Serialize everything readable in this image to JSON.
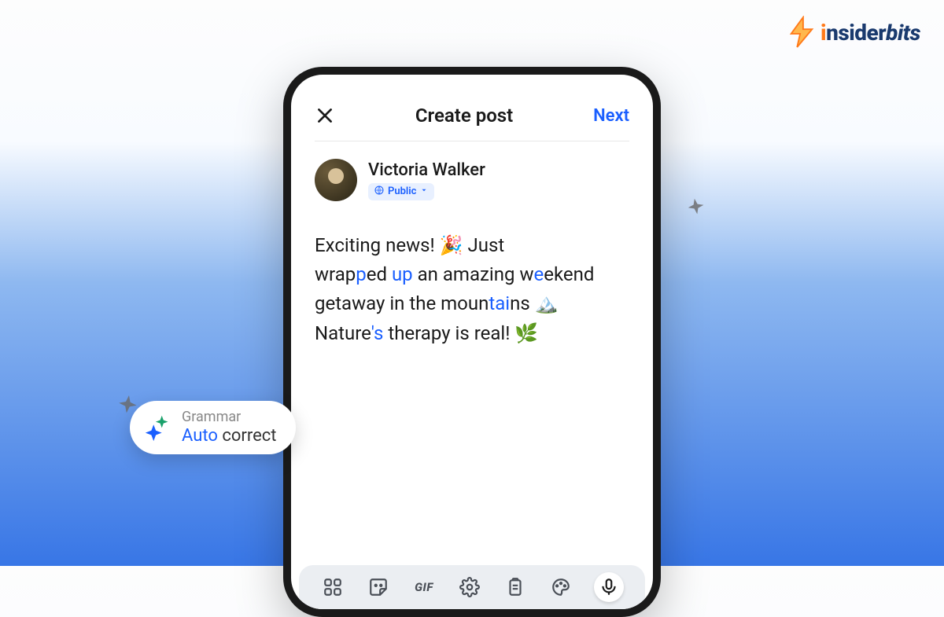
{
  "logo": {
    "prefix": "i",
    "mid": "nsider",
    "suffix": "bits"
  },
  "header": {
    "title": "Create post",
    "next_label": "Next"
  },
  "profile": {
    "name": "Victoria Walker",
    "visibility_label": "Public"
  },
  "post": {
    "line1_pre": "Exciting news! ",
    "emoji1": "🎉",
    "line1_post": " Just",
    "line2_w1": "wrap",
    "line2_h1": "p",
    "line2_w2": "ed ",
    "line2_h2": "up",
    "line2_w3": " an amazing w",
    "line2_h3": "e",
    "line2_w4": "ekend",
    "line3_pre": "getaway in the moun",
    "line3_h1": "tai",
    "line3_post": "ns ",
    "emoji2": "🏔️",
    "line4_pre": "Nature",
    "line4_h1": "'s",
    "line4_post": " therapy is real! ",
    "emoji3": "🌿"
  },
  "grammar": {
    "top": "Grammar",
    "auto": "Auto",
    "correct": " correct"
  },
  "keyboard": {
    "gif_label": "GIF"
  }
}
